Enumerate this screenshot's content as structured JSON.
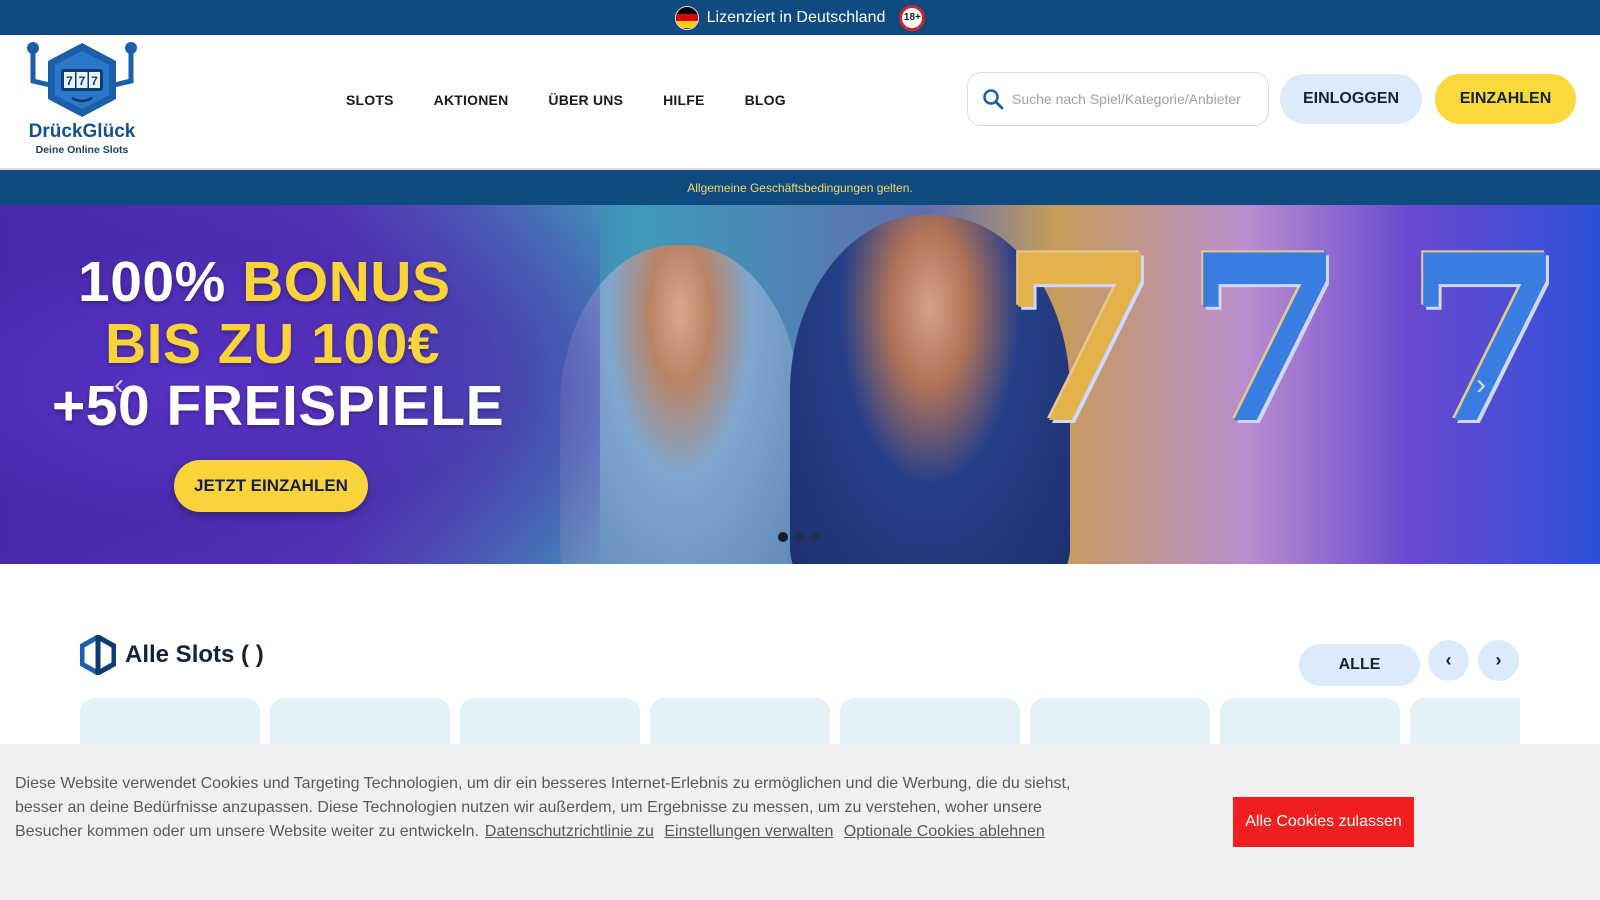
{
  "license_bar": {
    "text": "Lizenziert in Deutschland",
    "age_badge": "18+",
    "flag_icon": "germany-flag-icon",
    "colors": {
      "bg": "#0f4a80",
      "flag": [
        "#000000",
        "#dd0000",
        "#ffce00"
      ]
    }
  },
  "header": {
    "logo": {
      "name": "DrückGlück",
      "tagline": "Deine Online Slots",
      "numbers": "777"
    },
    "nav": [
      {
        "label": "SLOTS"
      },
      {
        "label": "AKTIONEN"
      },
      {
        "label": "ÜBER UNS"
      },
      {
        "label": "HILFE"
      },
      {
        "label": "BLOG"
      }
    ],
    "search": {
      "placeholder": "Suche nach Spiel/Kategorie/Anbieter",
      "icon": "search-icon"
    },
    "login_label": "EINLOGGEN",
    "deposit_label": "EINZAHLEN"
  },
  "terms_bar": {
    "text": "Allgemeine Geschäftsbedingungen gelten."
  },
  "hero": {
    "line1_white": "100%",
    "line1_yellow": "BONUS",
    "line2": "BIS ZU 100€",
    "line3": "+50 FREISPIELE",
    "cta_label": "JETZT EINZAHLEN",
    "seven": "7",
    "prev_icon": "chevron-left-icon",
    "next_icon": "chevron-right-icon",
    "slides": 3,
    "active_slide": 1
  },
  "slots_section": {
    "title": "Alle Slots ( )",
    "filter_label": "ALLE",
    "prev_icon": "chevron-left-icon",
    "next_icon": "chevron-right-icon",
    "cards": 8
  },
  "cookie_banner": {
    "text": "Diese Website verwendet Cookies und Targeting Technologien, um dir ein besseres Internet-Erlebnis zu ermöglichen und die Werbung, die du siehst, besser an deine Bedürfnisse anzupassen. Diese Technologien nutzen wir außerdem, um Ergebnisse zu messen, um zu verstehen, woher unsere Besucher kommen oder um unsere Website weiter zu entwickeln.",
    "privacy_link": "Datenschutzrichtlinie zu",
    "settings_link": "Einstellungen verwalten",
    "reject_link": "Optionale Cookies ablehnen",
    "accept_label": "Alle Cookies zulassen",
    "accept_color": "#f01e1e"
  }
}
